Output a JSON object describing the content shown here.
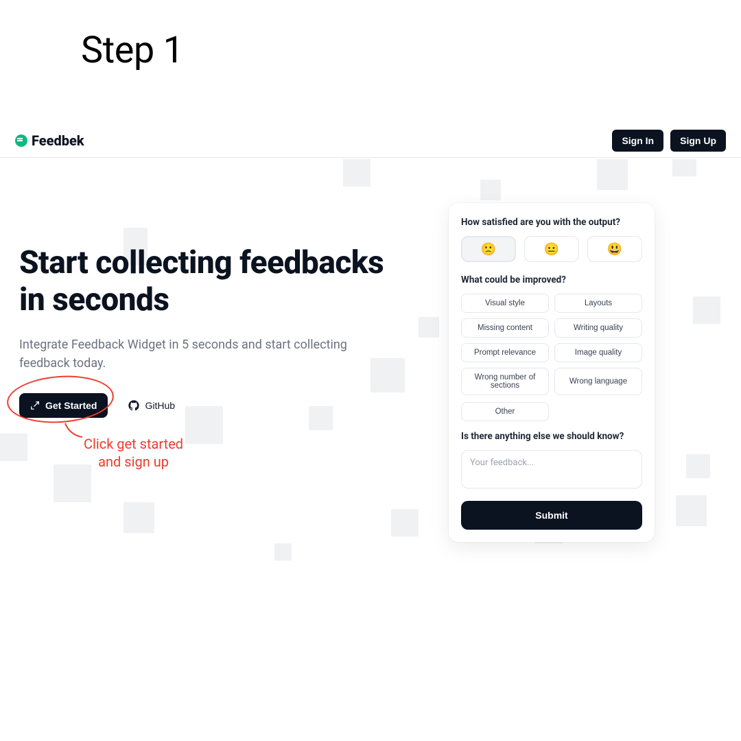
{
  "step_label": "Step 1",
  "brand": "Feedbek",
  "nav": {
    "sign_in": "Sign In",
    "sign_up": "Sign Up"
  },
  "hero": {
    "title": "Start collecting feedbacks in seconds",
    "subtitle": "Integrate Feedback Widget in 5 seconds and start collecting feedback today.",
    "cta_primary": "Get Started",
    "cta_secondary": "GitHub"
  },
  "annotation": {
    "line1": "Click get started",
    "line2": "and sign up"
  },
  "widget": {
    "q1": "How satisfied are you with the output?",
    "emojis": {
      "sad": "🙁",
      "neutral": "😐",
      "happy": "😃"
    },
    "q2": "What could be improved?",
    "chips": [
      "Visual style",
      "Layouts",
      "Missing content",
      "Writing quality",
      "Prompt relevance",
      "Image quality",
      "Wrong number of sections",
      "Wrong language"
    ],
    "chip_other": "Other",
    "q3": "Is there anything else we should know?",
    "placeholder": "Your feedback...",
    "submit": "Submit"
  },
  "colors": {
    "accent": "#10b981",
    "dark": "#0b1220",
    "annotation": "#ef3b2d"
  }
}
